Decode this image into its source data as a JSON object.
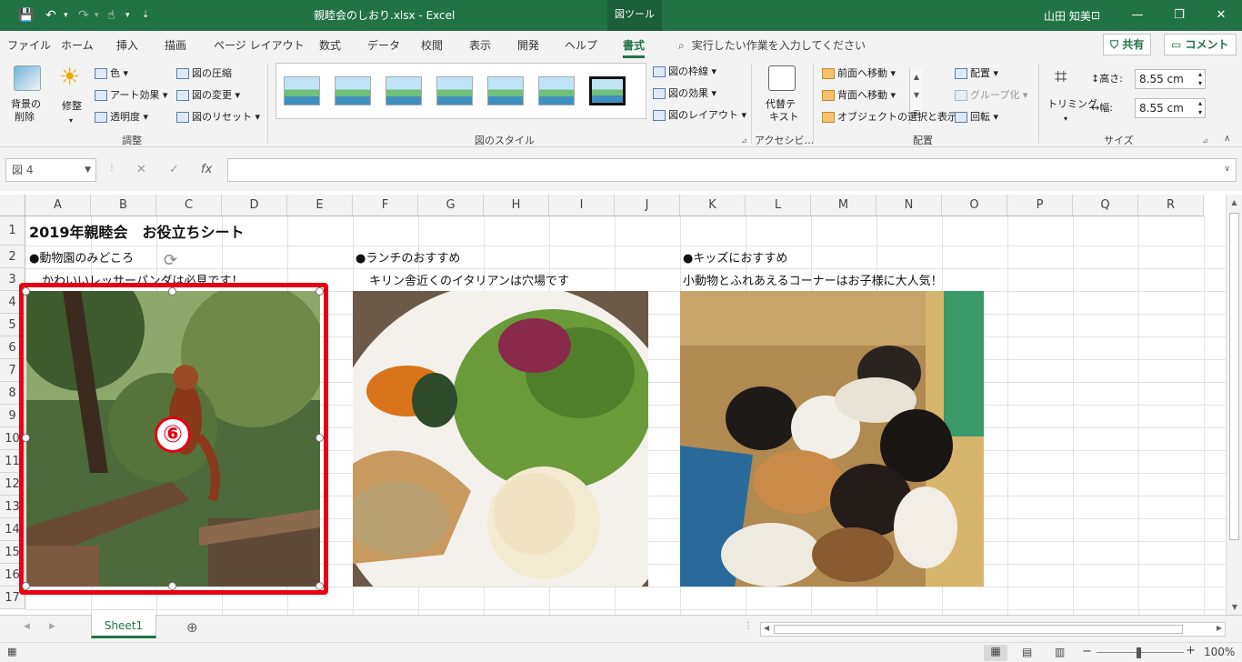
{
  "titlebar": {
    "doc_title": "親睦会のしおり.xlsx  -  Excel",
    "context_tab": "図ツール",
    "user": "山田 知美",
    "undo_icon": "undo-icon",
    "redo_icon": "redo-icon",
    "save_icon": "save-icon",
    "touch_icon": "touch-mode-icon"
  },
  "tabs": [
    "ファイル",
    "ホーム",
    "挿入",
    "描画",
    "ページ レイアウト",
    "数式",
    "データ",
    "校閲",
    "表示",
    "開発",
    "ヘルプ",
    "書式"
  ],
  "active_tab": "書式",
  "tellme": "実行したい作業を入力してください",
  "share_label": "共有",
  "comment_label": "コメント",
  "ribbon": {
    "remove_bg": [
      "背景の",
      "削除"
    ],
    "corrections": "修整",
    "color": "色",
    "artistic": "アート効果",
    "transparency": "透明度",
    "compress": "図の圧縮",
    "change": "図の変更",
    "reset": "図のリセット",
    "adjust_group": "調整",
    "styles_group": "図のスタイル",
    "border": "図の枠線",
    "effects": "図の効果",
    "layout": "図のレイアウト",
    "alt_text": [
      "代替テ",
      "キスト"
    ],
    "access_group": "アクセシビ…",
    "bring_forward": "前面へ移動",
    "send_backward": "背面へ移動",
    "selection_pane": "オブジェクトの選択と表示",
    "align": "配置",
    "group": "グループ化",
    "rotate": "回転",
    "arrange_group": "配置",
    "crop": "トリミング",
    "height_label": "高さ:",
    "height_value": "8.55 cm",
    "width_label": "幅:",
    "width_value": "8.55 cm",
    "size_group": "サイズ"
  },
  "formula": {
    "name_box": "図 4",
    "fx": "fx",
    "cancel": "✕",
    "enter": "✓"
  },
  "columns": [
    "A",
    "B",
    "C",
    "D",
    "E",
    "F",
    "G",
    "H",
    "I",
    "J",
    "K",
    "L",
    "M",
    "N",
    "O",
    "P",
    "Q",
    "R"
  ],
  "rows": [
    "1",
    "2",
    "3",
    "4",
    "5",
    "6",
    "7",
    "8",
    "9",
    "10",
    "11",
    "12",
    "13",
    "14",
    "15",
    "16",
    "17"
  ],
  "cells": {
    "A1": "2019年親睦会　お役立ちシート",
    "A2": "●動物園のみどころ",
    "A3": "かわいいレッサーパンダは必見です！",
    "F2": "●ランチのおすすめ",
    "F3": "キリン舎近くのイタリアンは穴場です",
    "K2": "●キッズにおすすめ",
    "K3": "小動物とふれあえるコーナーはお子様に大人気！"
  },
  "callout": "⑥",
  "sheet_tab": "Sheet1",
  "status": {
    "zoom": "100%"
  }
}
